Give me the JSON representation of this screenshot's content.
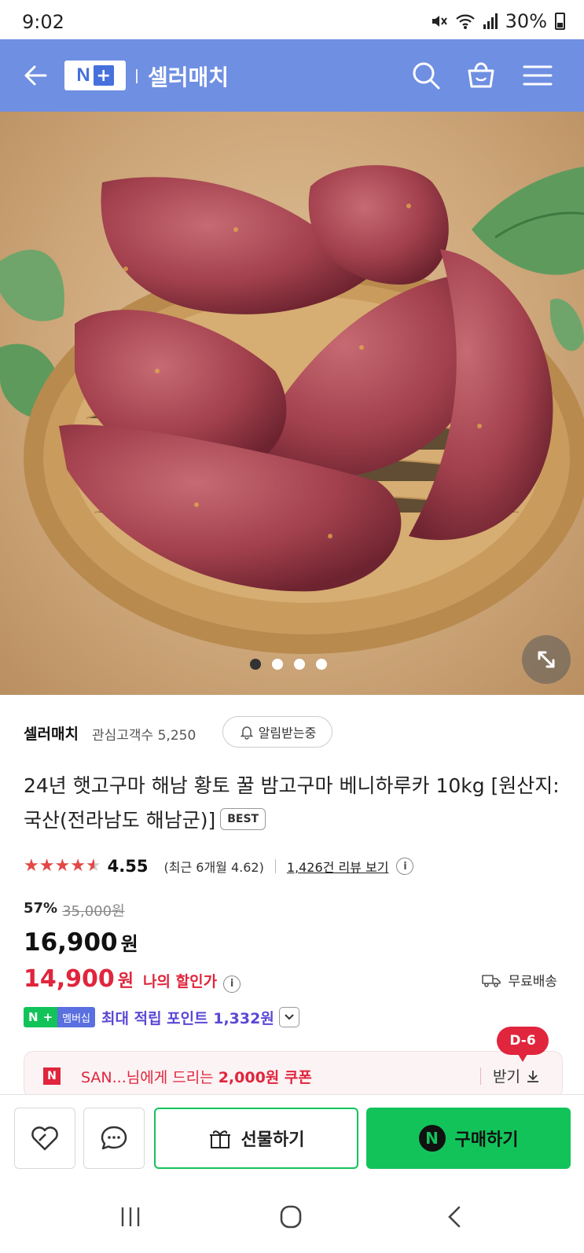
{
  "status_bar": {
    "time": "9:02",
    "battery": "30%"
  },
  "header": {
    "logo_n": "N",
    "logo_plus": "+",
    "store_name": "셀러매치"
  },
  "hero": {
    "image_count": 4,
    "active_index": 0
  },
  "seller": {
    "name": "셀러매치",
    "followers_label": "관심고객수",
    "followers_count": "5,250",
    "alarm_label": "알림받는중"
  },
  "product": {
    "title": "24년 햇고구마 해남 황토 꿀 밤고구마 베니하루카 10kg [원산지:국산(전라남도 해남군)]",
    "badge": "BEST",
    "rating": "4.55",
    "rating_value": 4.55,
    "recent_rating": "(최근 6개월 4.62)",
    "review_link": "1,426건 리뷰 보기",
    "info_glyph": "i",
    "discount_rate": "57%",
    "original_price": "35,000원",
    "price": "16,900",
    "won": "원",
    "my_price": "14,900",
    "my_price_label": "나의 할인가",
    "shipping": "무료배송"
  },
  "points": {
    "np_n": "N",
    "np_plus": "+",
    "membership": "멤버십",
    "text": "최대 적립 포인트 1,332원"
  },
  "coupon": {
    "dday": "D-6",
    "logo": "N",
    "prefix": "SAN...님에게 드리는 ",
    "amount": "2,000원 쿠폰",
    "action": "받기"
  },
  "actions": {
    "gift": "선물하기",
    "buy": "구매하기",
    "buy_n": "N"
  },
  "colors": {
    "header_bg": "#6f8fe2",
    "naver_green": "#12c35a",
    "sale_red": "#e0253d",
    "point_purple": "#5a48d6",
    "star_red": "#e24848"
  }
}
